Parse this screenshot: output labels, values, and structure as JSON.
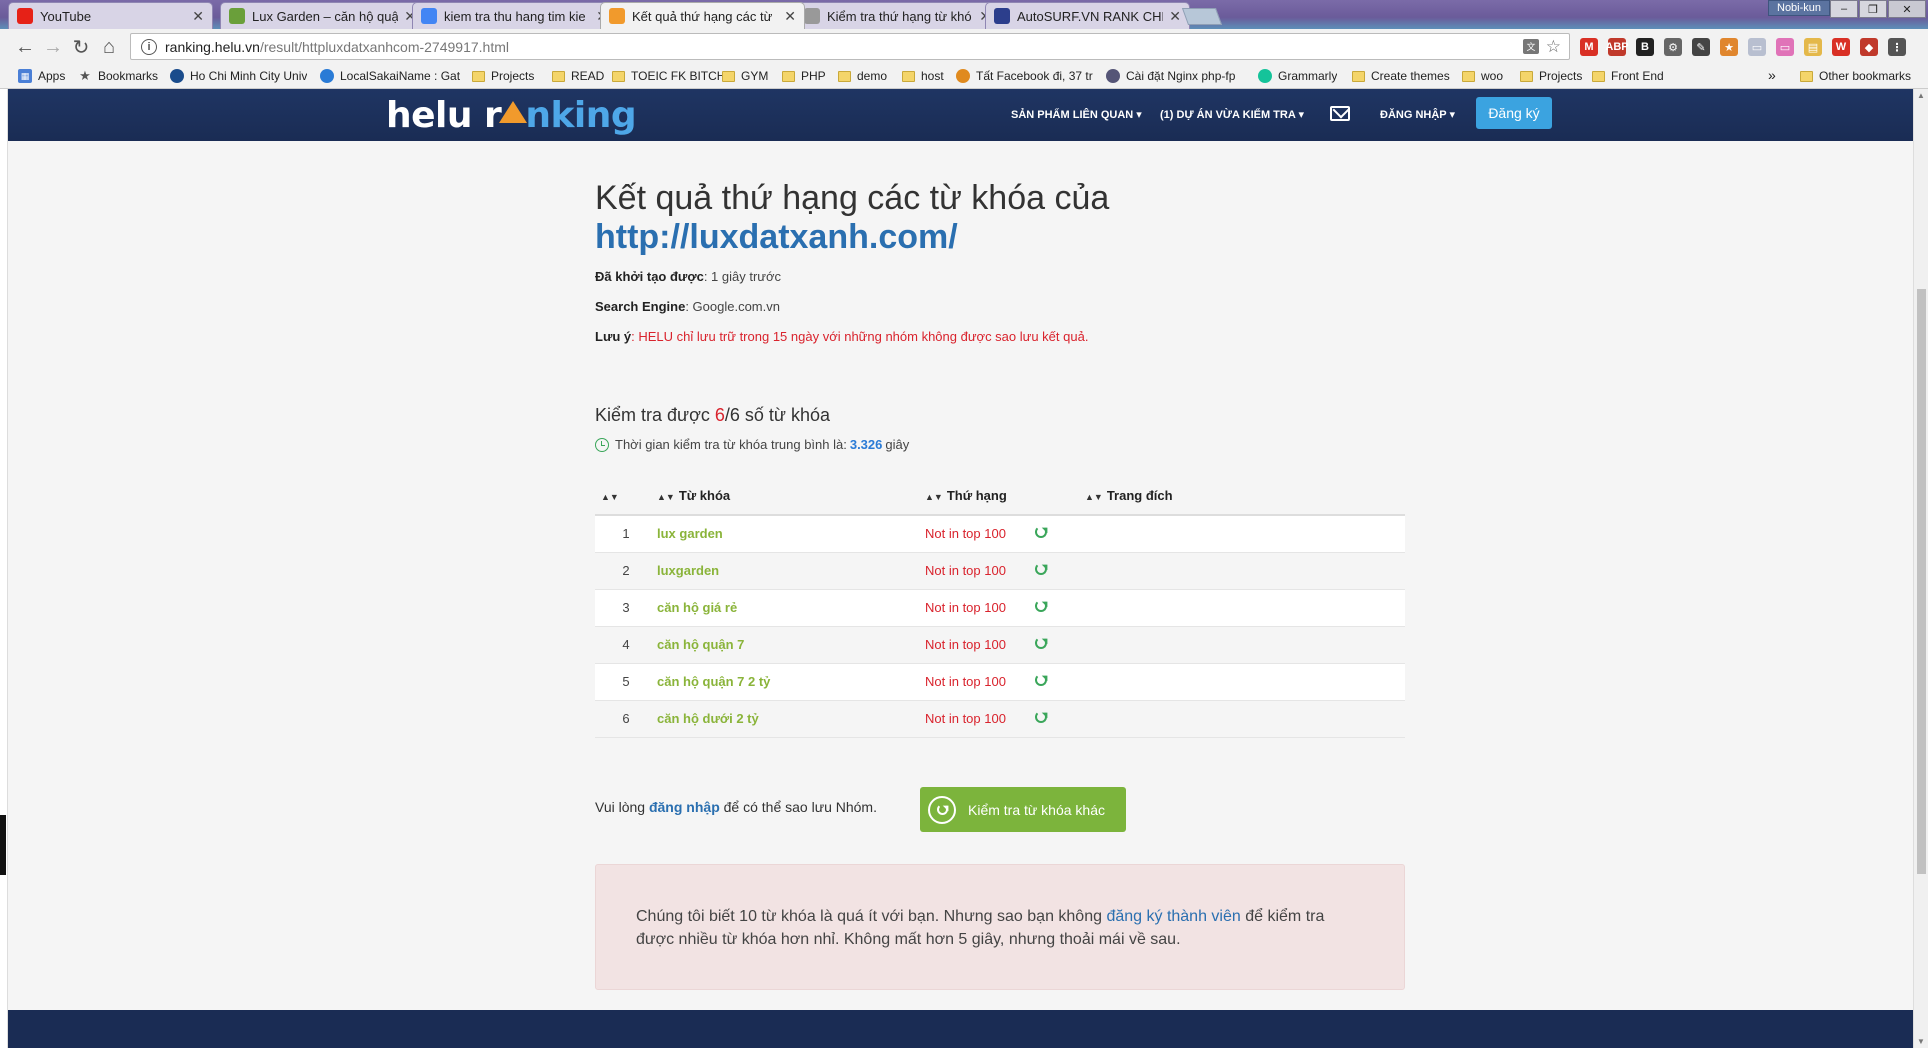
{
  "tabs": [
    {
      "title": "YouTube",
      "icon": "youtube-icon",
      "color": "#e62117",
      "active": false
    },
    {
      "title": "Lux Garden – căn hộ quậ",
      "icon": "site-icon",
      "color": "#6a9f3a",
      "active": false
    },
    {
      "title": "kiem tra thu hang tim kie",
      "icon": "google-icon",
      "color": "#4285f4",
      "active": false
    },
    {
      "title": "Kết quả thứ hạng các từ",
      "icon": "helu-icon",
      "color": "#f19a2c",
      "active": true
    },
    {
      "title": "Kiểm tra thứ hạng từ khó",
      "icon": "page-icon",
      "color": "#999999",
      "active": false
    },
    {
      "title": "AutoSURF.VN RANK CHE",
      "icon": "autosurf-icon",
      "color": "#2c3e8c",
      "active": false
    }
  ],
  "window": {
    "user": "Nobi-kun",
    "minimize": "–",
    "restore": "❐",
    "close": "✕"
  },
  "address": {
    "host": "ranking.helu.vn",
    "path": "/result/httpluxdatxanhcom-2749917.html"
  },
  "extensions": [
    {
      "label": "M",
      "color": "#d93025"
    },
    {
      "label": "ABP",
      "color": "#c0392b"
    },
    {
      "label": "B",
      "color": "#222222"
    },
    {
      "label": "⚙",
      "color": "#666666"
    },
    {
      "label": "✎",
      "color": "#444444"
    },
    {
      "label": "★",
      "color": "#e0862e"
    },
    {
      "label": "▭",
      "color": "#b8bfd0"
    },
    {
      "label": "▭",
      "color": "#e073b8"
    },
    {
      "label": "▤",
      "color": "#e4b84a"
    },
    {
      "label": "W",
      "color": "#d93025"
    },
    {
      "label": "◆",
      "color": "#c0392b"
    },
    {
      "label": "⋮",
      "color": "#555555"
    }
  ],
  "bookmarks": [
    {
      "label": "Apps",
      "kind": "apps"
    },
    {
      "label": "Bookmarks",
      "kind": "star"
    },
    {
      "label": "Ho Chi Minh City Univ",
      "kind": "site",
      "color": "#1a4c8c"
    },
    {
      "label": "LocalSakaiName : Gat",
      "kind": "site",
      "color": "#2a7bd6"
    },
    {
      "label": "Projects",
      "kind": "folder"
    },
    {
      "label": "READ",
      "kind": "folder"
    },
    {
      "label": "TOEIC FK BITCH",
      "kind": "folder"
    },
    {
      "label": "GYM",
      "kind": "folder"
    },
    {
      "label": "PHP",
      "kind": "folder"
    },
    {
      "label": "demo",
      "kind": "folder"
    },
    {
      "label": "host",
      "kind": "folder"
    },
    {
      "label": "Tất Facebook đi, 37 tr",
      "kind": "site",
      "color": "#e08a1e"
    },
    {
      "label": "Cài đặt Nginx php-fp",
      "kind": "site",
      "color": "#557"
    },
    {
      "label": "Grammarly",
      "kind": "site",
      "color": "#15c39a"
    },
    {
      "label": "Create themes",
      "kind": "folder"
    },
    {
      "label": "woo",
      "kind": "folder"
    },
    {
      "label": "Projects",
      "kind": "folder"
    },
    {
      "label": "Front End",
      "kind": "folder"
    }
  ],
  "bookmarks_more": "»",
  "other_bookmarks": "Other bookmarks",
  "site": {
    "logo_left": "helu r",
    "logo_right": "nking",
    "menu_products": "SẢN PHẨM LIÊN QUAN",
    "menu_projects": "(1) DỰ ÁN VỪA KIỂM TRA",
    "menu_login": "ĐĂNG NHẬP",
    "signup": "Đăng ký"
  },
  "result": {
    "title": "Kết quả thứ hạng các từ khóa của",
    "url": "http://luxdatxanh.com/",
    "created_label": "Đã khởi tạo được",
    "created_value": ": 1 giây trước",
    "engine_label": "Search Engine",
    "engine_value": ": Google.com.vn",
    "note_label": "Lưu ý",
    "note_value": ": HELU chỉ lưu trữ trong 15 ngày với những nhóm không được sao lưu kết quả.",
    "checked_prefix": "Kiểm tra được ",
    "checked_count": "6",
    "checked_total": "/6 số từ khóa",
    "avg_prefix": "Thời gian kiểm tra từ khóa trung bình là:",
    "avg_value": "3.326",
    "avg_unit": "giây"
  },
  "table": {
    "headers": {
      "keyword": "Từ khóa",
      "rank": "Thứ hạng",
      "target": "Trang đích"
    },
    "rows": [
      {
        "idx": "1",
        "keyword": "lux garden",
        "rank": "Not in top 100",
        "target": ""
      },
      {
        "idx": "2",
        "keyword": "luxgarden",
        "rank": "Not in top 100",
        "target": ""
      },
      {
        "idx": "3",
        "keyword": "căn hộ giá rẻ",
        "rank": "Not in top 100",
        "target": ""
      },
      {
        "idx": "4",
        "keyword": "căn hộ quận 7",
        "rank": "Not in top 100",
        "target": ""
      },
      {
        "idx": "5",
        "keyword": "căn hộ quận 7 2 tỷ",
        "rank": "Not in top 100",
        "target": ""
      },
      {
        "idx": "6",
        "keyword": "căn hộ dưới 2 tỷ",
        "rank": "Not in top 100",
        "target": ""
      }
    ]
  },
  "login_prompt": {
    "before": "Vui lòng ",
    "link": "đăng nhập",
    "after": " để có thể sao lưu Nhóm."
  },
  "check_other_button": "Kiểm tra từ khóa khác",
  "promo": {
    "text1": "Chúng tôi biết 10 từ khóa là quá ít với bạn. Nhưng sao bạn không ",
    "link": "đăng ký thành viên",
    "text2": " để kiểm tra được nhiều từ khóa hơn nhỉ. Không mất hơn 5 giây, nhưng thoải mái về sau."
  }
}
